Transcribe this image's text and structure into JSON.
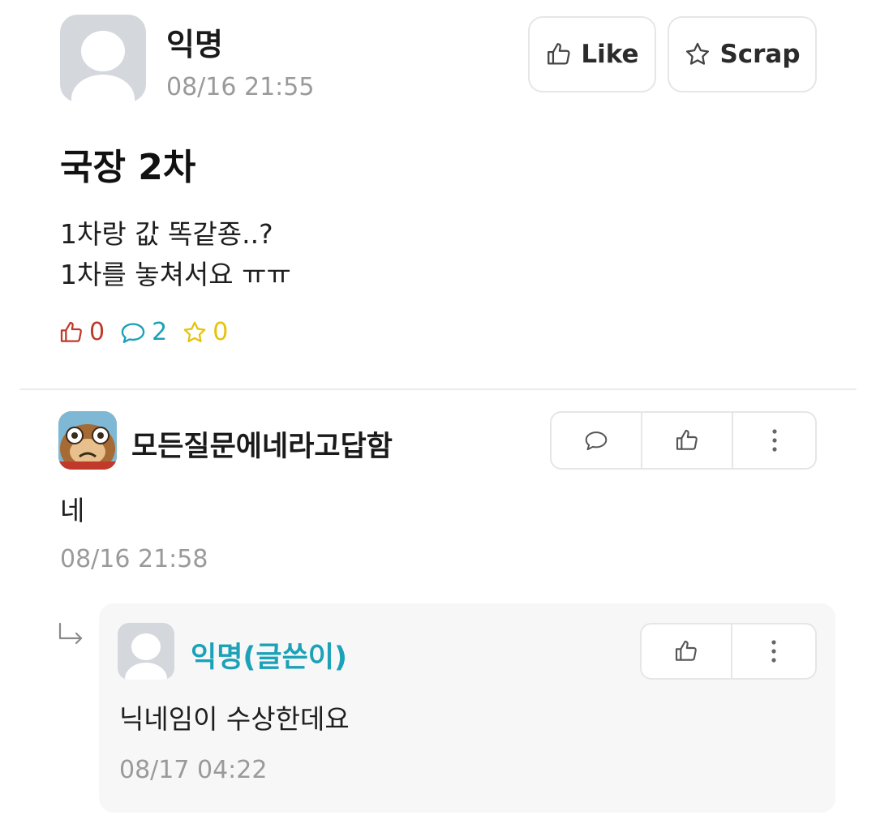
{
  "post": {
    "author": "익명",
    "timestamp": "08/16 21:55",
    "like_button_label": "Like",
    "scrap_button_label": "Scrap",
    "title": "국장 2차",
    "body_lines": [
      "1차랑 값 똑같죵..?",
      "1차를 놓쳐서요 ㅠㅠ"
    ],
    "stats": {
      "likes": "0",
      "comments": "2",
      "scraps": "0"
    }
  },
  "comment": {
    "author": "모든질문에네라고답함",
    "text": "네",
    "timestamp": "08/16 21:58"
  },
  "reply": {
    "author": "익명(글쓴이)",
    "text": "닉네임이 수상한데요",
    "timestamp": "08/17 04:22"
  },
  "colors": {
    "like_stat": "#c0392b",
    "comment_stat": "#1ba1b8",
    "scrap_stat": "#e6c20a",
    "author_teal": "#1ba1b8",
    "meta_gray": "#9a9a9a"
  },
  "icons": {
    "like": "thumbs-up-icon",
    "scrap": "star-icon",
    "comment": "speech-bubble-icon",
    "more": "vertical-dots-icon",
    "reply_arrow": "reply-arrow-icon"
  }
}
